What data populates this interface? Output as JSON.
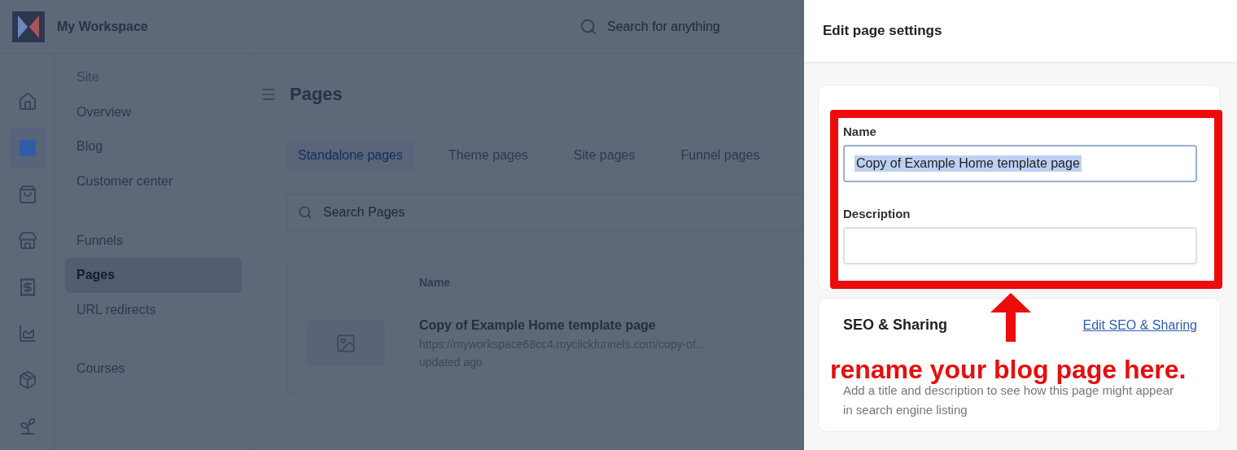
{
  "workspace": {
    "name": "My Workspace"
  },
  "global_search": {
    "placeholder": "Search for anything"
  },
  "icon_rail": [
    {
      "selected": false
    },
    {
      "selected": true
    },
    {
      "selected": false
    },
    {
      "selected": false
    },
    {
      "selected": false
    },
    {
      "selected": false
    },
    {
      "selected": false
    },
    {
      "selected": false
    }
  ],
  "nav": [
    {
      "kind": "header",
      "label": "Site"
    },
    {
      "kind": "item",
      "label": "Overview",
      "selected": false
    },
    {
      "kind": "item",
      "label": "Blog",
      "selected": false
    },
    {
      "kind": "item",
      "label": "Customer center",
      "selected": false
    },
    {
      "kind": "spacer"
    },
    {
      "kind": "item",
      "label": "Funnels",
      "selected": false
    },
    {
      "kind": "item",
      "label": "Pages",
      "selected": true
    },
    {
      "kind": "item",
      "label": "URL redirects",
      "selected": false
    },
    {
      "kind": "spacer"
    },
    {
      "kind": "item",
      "label": "Courses",
      "selected": false
    }
  ],
  "page": {
    "title": "Pages",
    "tabs": [
      {
        "label": "Standalone pages",
        "selected": true
      },
      {
        "label": "Theme pages",
        "selected": false
      },
      {
        "label": "Site pages",
        "selected": false
      },
      {
        "label": "Funnel pages",
        "selected": false
      }
    ],
    "search": {
      "placeholder": "Search Pages"
    },
    "table": {
      "columns": [
        "Name"
      ],
      "rows": [
        {
          "name": "Copy of Example Home template page",
          "url": "https://myworkspace68cc4.myclickfunnels.com/copy-of...",
          "updated": "updated ago"
        }
      ]
    }
  },
  "settings_panel": {
    "title": "Edit page settings",
    "fields": [
      {
        "label": "Name",
        "value": "Copy of Example Home template page",
        "text_selected": true
      },
      {
        "label": "Description",
        "text_selected": false
      }
    ],
    "seo": {
      "title": "SEO & Sharing",
      "link": "Edit SEO & Sharing",
      "description": "Add a title and description to see how this page might appear in search engine listing"
    }
  },
  "annotation": {
    "text": "rename your blog page here."
  }
}
